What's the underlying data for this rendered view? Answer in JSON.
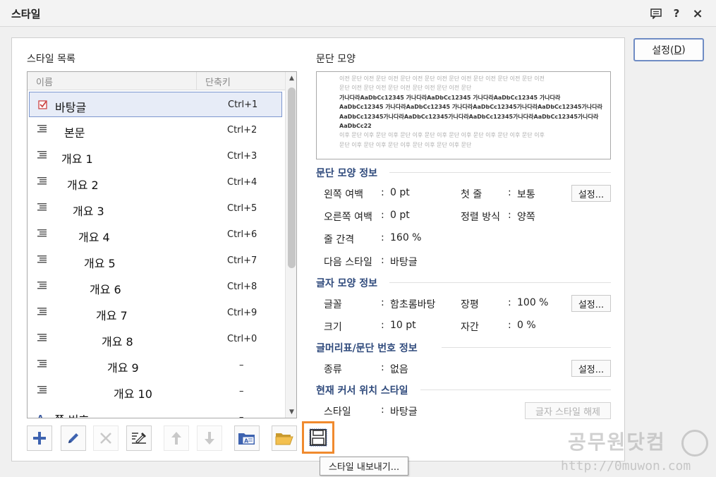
{
  "window": {
    "title": "스타일",
    "help_label": "?",
    "close_label": "×"
  },
  "settings_button": {
    "label_prefix": "설정(",
    "mnemonic": "D",
    "label_suffix": ")"
  },
  "style_list": {
    "title": "스타일 목록",
    "col_name": "이름",
    "col_shortcut": "단축키",
    "items": [
      {
        "name": "바탕글",
        "shortcut": "Ctrl+1",
        "selected": true
      },
      {
        "name": "본문",
        "shortcut": "Ctrl+2"
      },
      {
        "name": "개요 1",
        "shortcut": "Ctrl+3"
      },
      {
        "name": "개요 2",
        "shortcut": "Ctrl+4"
      },
      {
        "name": "개요 3",
        "shortcut": "Ctrl+5"
      },
      {
        "name": "개요 4",
        "shortcut": "Ctrl+6"
      },
      {
        "name": "개요 5",
        "shortcut": "Ctrl+7"
      },
      {
        "name": "개요 6",
        "shortcut": "Ctrl+8"
      },
      {
        "name": "개요 7",
        "shortcut": "Ctrl+9"
      },
      {
        "name": "개요 8",
        "shortcut": "Ctrl+0"
      },
      {
        "name": "개요 9",
        "shortcut": "–"
      },
      {
        "name": "개요 10",
        "shortcut": "–"
      },
      {
        "name": "쪽 번호",
        "shortcut": "–"
      }
    ]
  },
  "tooltip": "스타일 내보내기...",
  "paragraph": {
    "title": "문단 모양",
    "preview": {
      "prev_line1": "이전 문단 이전 문단 이전 문단 이전 문단 이전 문단 이전 문단 이전 문단 이전 문단 이전",
      "prev_line2": "문단 이전 문단 이전 문단 이전 문단 이전 문단 이전 문단",
      "main_line1": "가나다라AaDbCc12345     가나다라AaDbCc12345     가나다라AaDbCc12345     가나다라",
      "main_line2": "AaDbCc12345  가나다라AaDbCc12345  가나다라AaDbCc12345가나다라AaDbCc12345가나다라",
      "main_line3": "AaDbCc12345가나다라AaDbCc12345가나다라AaDbCc12345가나다라AaDbCc12345가나다라",
      "main_line4": "AaDbCc22",
      "next_line1": "이후 문단 이후 문단 이후 문단 이후 문단 이후 문단 이후 문단 이후 문단 이후 문단 이후",
      "next_line2": "문단 이후 문단 이후 문단 이후 문단 이후 문단 이후 문단"
    },
    "info_title": "문단 모양 정보",
    "left_margin_label": "왼쪽 여백",
    "left_margin_value": "0 pt",
    "right_margin_label": "오른쪽 여백",
    "right_margin_value": "0 pt",
    "line_spacing_label": "줄 간격",
    "line_spacing_value": "160 %",
    "next_style_label": "다음 스타일",
    "next_style_value": "바탕글",
    "first_line_label": "첫 줄",
    "first_line_value": "보통",
    "align_label": "정렬 방식",
    "align_value": "양쪽",
    "settings_label": "설정..."
  },
  "char": {
    "info_title": "글자 모양 정보",
    "font_label": "글꼴",
    "font_value": "함초롬바탕",
    "size_label": "크기",
    "size_value": "10 pt",
    "ratio_label": "장평",
    "ratio_value": "100 %",
    "spacing_label": "자간",
    "spacing_value": "0 %",
    "settings_label": "설정..."
  },
  "bullet": {
    "info_title": "글머리표/문단 번호 정보",
    "type_label": "종류",
    "type_value": "없음",
    "settings_label": "설정..."
  },
  "cursor": {
    "info_title": "현재 커서 위치 스타일",
    "style_label": "스타일",
    "style_value": "바탕글",
    "release_label": "글자 스타일 해제"
  },
  "colon": ":",
  "watermark": {
    "line1": "공무원닷컴",
    "line2": "http://0muwon.com"
  },
  "colors": {
    "accent": "#2f4a7c",
    "highlight": "#f08a2e",
    "selection": "#e7ecf7"
  }
}
